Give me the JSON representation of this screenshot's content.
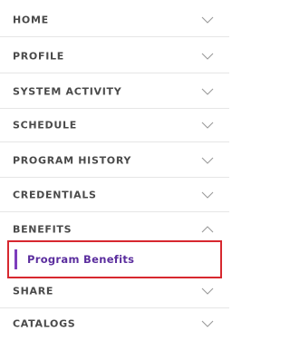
{
  "nav": {
    "items": [
      {
        "label": "HOME",
        "expanded": false
      },
      {
        "label": "PROFILE",
        "expanded": false
      },
      {
        "label": "SYSTEM ACTIVITY",
        "expanded": false
      },
      {
        "label": "SCHEDULE",
        "expanded": false
      },
      {
        "label": "PROGRAM HISTORY",
        "expanded": false
      },
      {
        "label": "CREDENTIALS",
        "expanded": false
      },
      {
        "label": "BENEFITS",
        "expanded": true
      },
      {
        "label": "SHARE",
        "expanded": false
      },
      {
        "label": "CATALOGS",
        "expanded": false
      }
    ],
    "benefits_sub": {
      "label": "Program Benefits"
    }
  },
  "colors": {
    "text": "#4a4a4a",
    "divider": "#e6e6e6",
    "chevron": "#9a9a9a",
    "accent": "#7d3dbc",
    "sub_text": "#5b2e9e",
    "highlight_border": "#d7282f"
  },
  "icons": {
    "collapsed": "chevron-down-icon",
    "expanded": "chevron-up-icon"
  }
}
